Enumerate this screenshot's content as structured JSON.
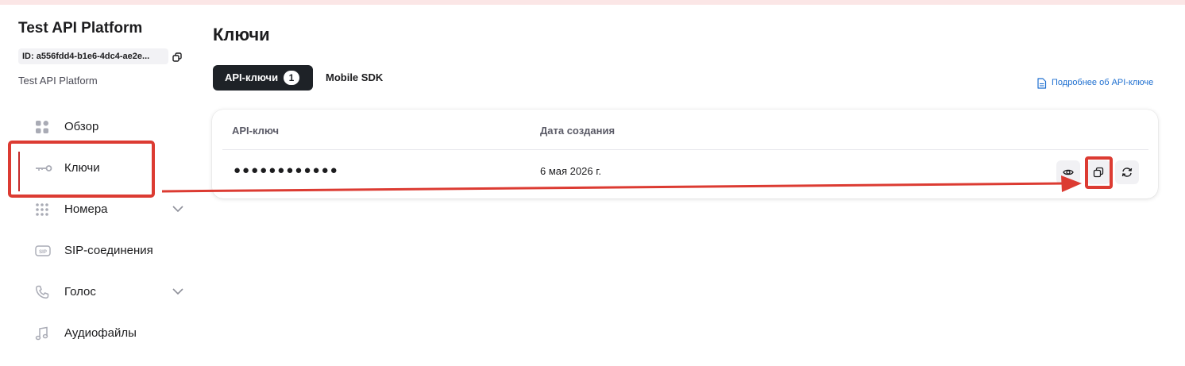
{
  "project": {
    "title": "Test API Platform",
    "id_label": "ID: a556fdd4-b1e6-4dc4-ae2e...",
    "subtitle": "Test API Platform"
  },
  "sidebar": {
    "items": [
      {
        "label": "Обзор",
        "icon": "grid-icon",
        "has_chevron": false,
        "active": false
      },
      {
        "label": "Ключи",
        "icon": "key-icon",
        "has_chevron": false,
        "active": true
      },
      {
        "label": "Номера",
        "icon": "dialpad-icon",
        "has_chevron": true,
        "active": false
      },
      {
        "label": "SIP-соединения",
        "icon": "sip-icon",
        "has_chevron": false,
        "active": false
      },
      {
        "label": "Голос",
        "icon": "phone-icon",
        "has_chevron": true,
        "active": false
      },
      {
        "label": "Аудиофайлы",
        "icon": "music-note-icon",
        "has_chevron": false,
        "active": false
      }
    ]
  },
  "main": {
    "title": "Ключи",
    "tabs": [
      {
        "label": "API-ключи",
        "badge": "1",
        "active": true
      },
      {
        "label": "Mobile SDK",
        "active": false
      }
    ],
    "doc_link": "Подробнее об API-ключе",
    "table": {
      "headers": [
        "API-ключ",
        "Дата создания"
      ],
      "rows": [
        {
          "key": "●●●●●●●●●●●●",
          "date": "6 мая 2026 г."
        }
      ]
    }
  },
  "colors": {
    "accent_red": "#dc3b32",
    "tab_active_bg": "#1e2227",
    "link_blue": "#1e6fd0",
    "top_band": "#fbe6e6"
  }
}
